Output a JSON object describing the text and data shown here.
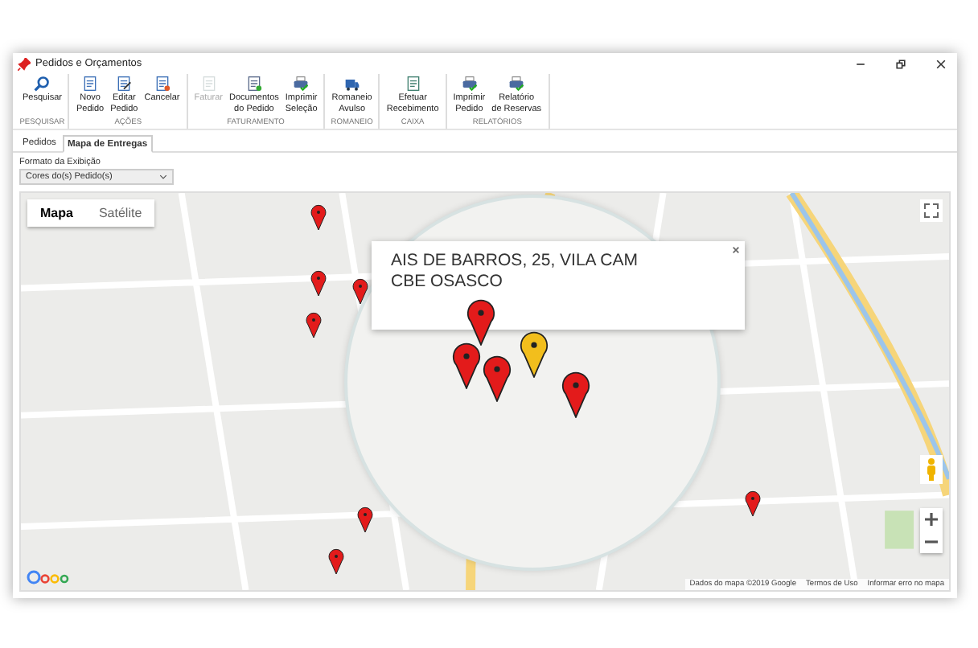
{
  "window": {
    "title": "Pedidos e Orçamentos"
  },
  "ribbon_groups": [
    {
      "label": "PESQUISAR",
      "buttons": [
        {
          "label": "Pesquisar",
          "disabled": false
        }
      ]
    },
    {
      "label": "AÇÕES",
      "buttons": [
        {
          "label": "Novo\nPedido",
          "disabled": false
        },
        {
          "label": "Editar\nPedido",
          "disabled": false
        },
        {
          "label": "Cancelar",
          "disabled": false
        }
      ]
    },
    {
      "label": "FATURAMENTO",
      "buttons": [
        {
          "label": "Faturar",
          "disabled": true
        },
        {
          "label": "Documentos\ndo Pedido",
          "disabled": false
        },
        {
          "label": "Imprimir\nSeleção",
          "disabled": false
        }
      ]
    },
    {
      "label": "ROMANEIO",
      "buttons": [
        {
          "label": "Romaneio\nAvulso",
          "disabled": false
        }
      ]
    },
    {
      "label": "CAIXA",
      "buttons": [
        {
          "label": "Efetuar\nRecebimento",
          "disabled": false
        }
      ]
    },
    {
      "label": "RELATÓRIOS",
      "buttons": [
        {
          "label": "Imprimir\nPedido",
          "disabled": false
        },
        {
          "label": "Relatório\nde Reservas",
          "disabled": false
        }
      ]
    }
  ],
  "tabs": [
    {
      "label": "Pedidos",
      "selected": false
    },
    {
      "label": "Mapa de Entregas",
      "selected": true
    }
  ],
  "display_format": {
    "label": "Formato da Exibição",
    "value": "Cores do(s) Pedido(s)"
  },
  "map": {
    "type_buttons": [
      {
        "label": "Mapa",
        "selected": true
      },
      {
        "label": "Satélite",
        "selected": false
      }
    ],
    "popup_lines": [
      "AIS DE BARROS, 25, VILA CAM",
      "CBE OSASCO"
    ],
    "markers": [
      {
        "color": "#e31b1b"
      },
      {
        "color": "#e31b1b"
      },
      {
        "color": "#e31b1b"
      },
      {
        "color": "#e31b1b"
      },
      {
        "color": "#e31b1b"
      },
      {
        "color": "#e31b1b"
      },
      {
        "color": "#e31b1b"
      },
      {
        "color": "#e31b1b"
      },
      {
        "color": "#e31b1b"
      },
      {
        "color": "#e31b1b"
      },
      {
        "color": "#f2be1c"
      },
      {
        "color": "#e31b1b"
      }
    ],
    "attribution": [
      "Dados do mapa ©2019 Google",
      "Termos de Uso",
      "Informar erro no mapa"
    ]
  }
}
